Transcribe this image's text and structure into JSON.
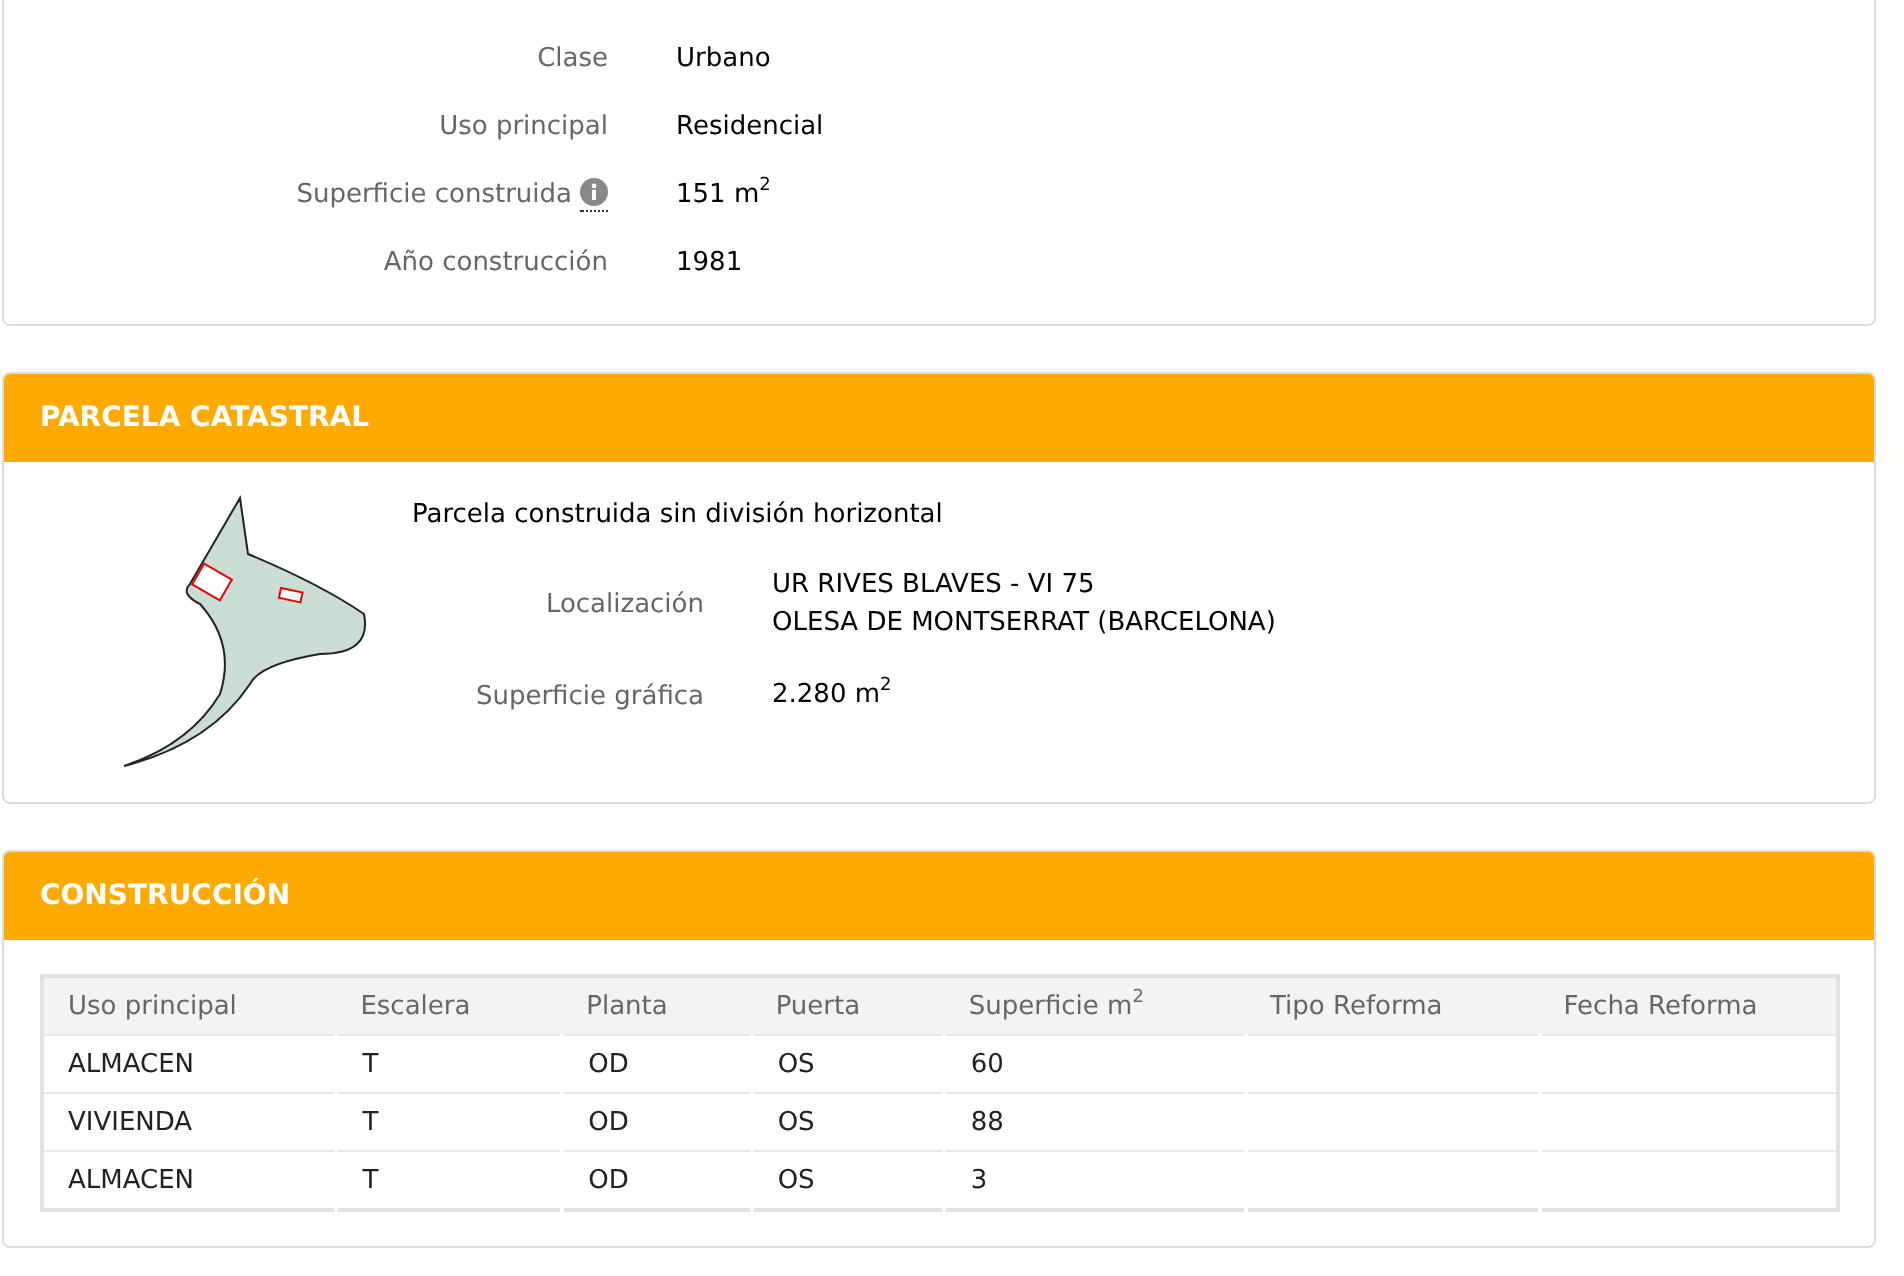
{
  "inmueble": {
    "fields": [
      {
        "label": "Clase",
        "value": "Urbano",
        "info": false
      },
      {
        "label": "Uso principal",
        "value": "Residencial",
        "info": false
      },
      {
        "label": "Superficie construida",
        "value": "151 m$^{2}$",
        "info": true
      },
      {
        "label": "Año construcción",
        "value": "1981",
        "info": false
      }
    ]
  },
  "parcela": {
    "title": "PARCELA CATASTRAL",
    "description": "Parcela construida sin división horizontal",
    "fields": [
      {
        "label": "Localización",
        "lines": [
          "UR RIVES BLAVES - VI 75",
          "OLESA DE MONTSERRAT (BARCELONA)"
        ]
      },
      {
        "label": "Superficie gráfica",
        "lines": [
          "2.280 m$^{2}$"
        ]
      }
    ]
  },
  "construccion": {
    "title": "CONSTRUCCIÓN",
    "table": {
      "columns": [
        "Uso principal",
        "Escalera",
        "Planta",
        "Puerta",
        "Superficie m$^{2}$",
        "Tipo Reforma",
        "Fecha Reforma"
      ],
      "rows": [
        [
          "ALMACEN",
          "T",
          "OD",
          "OS",
          "60",
          "",
          ""
        ],
        [
          "VIVIENDA",
          "T",
          "OD",
          "OS",
          "88",
          "",
          ""
        ],
        [
          "ALMACEN",
          "T",
          "OD",
          "OS",
          "3",
          "",
          ""
        ]
      ]
    }
  }
}
